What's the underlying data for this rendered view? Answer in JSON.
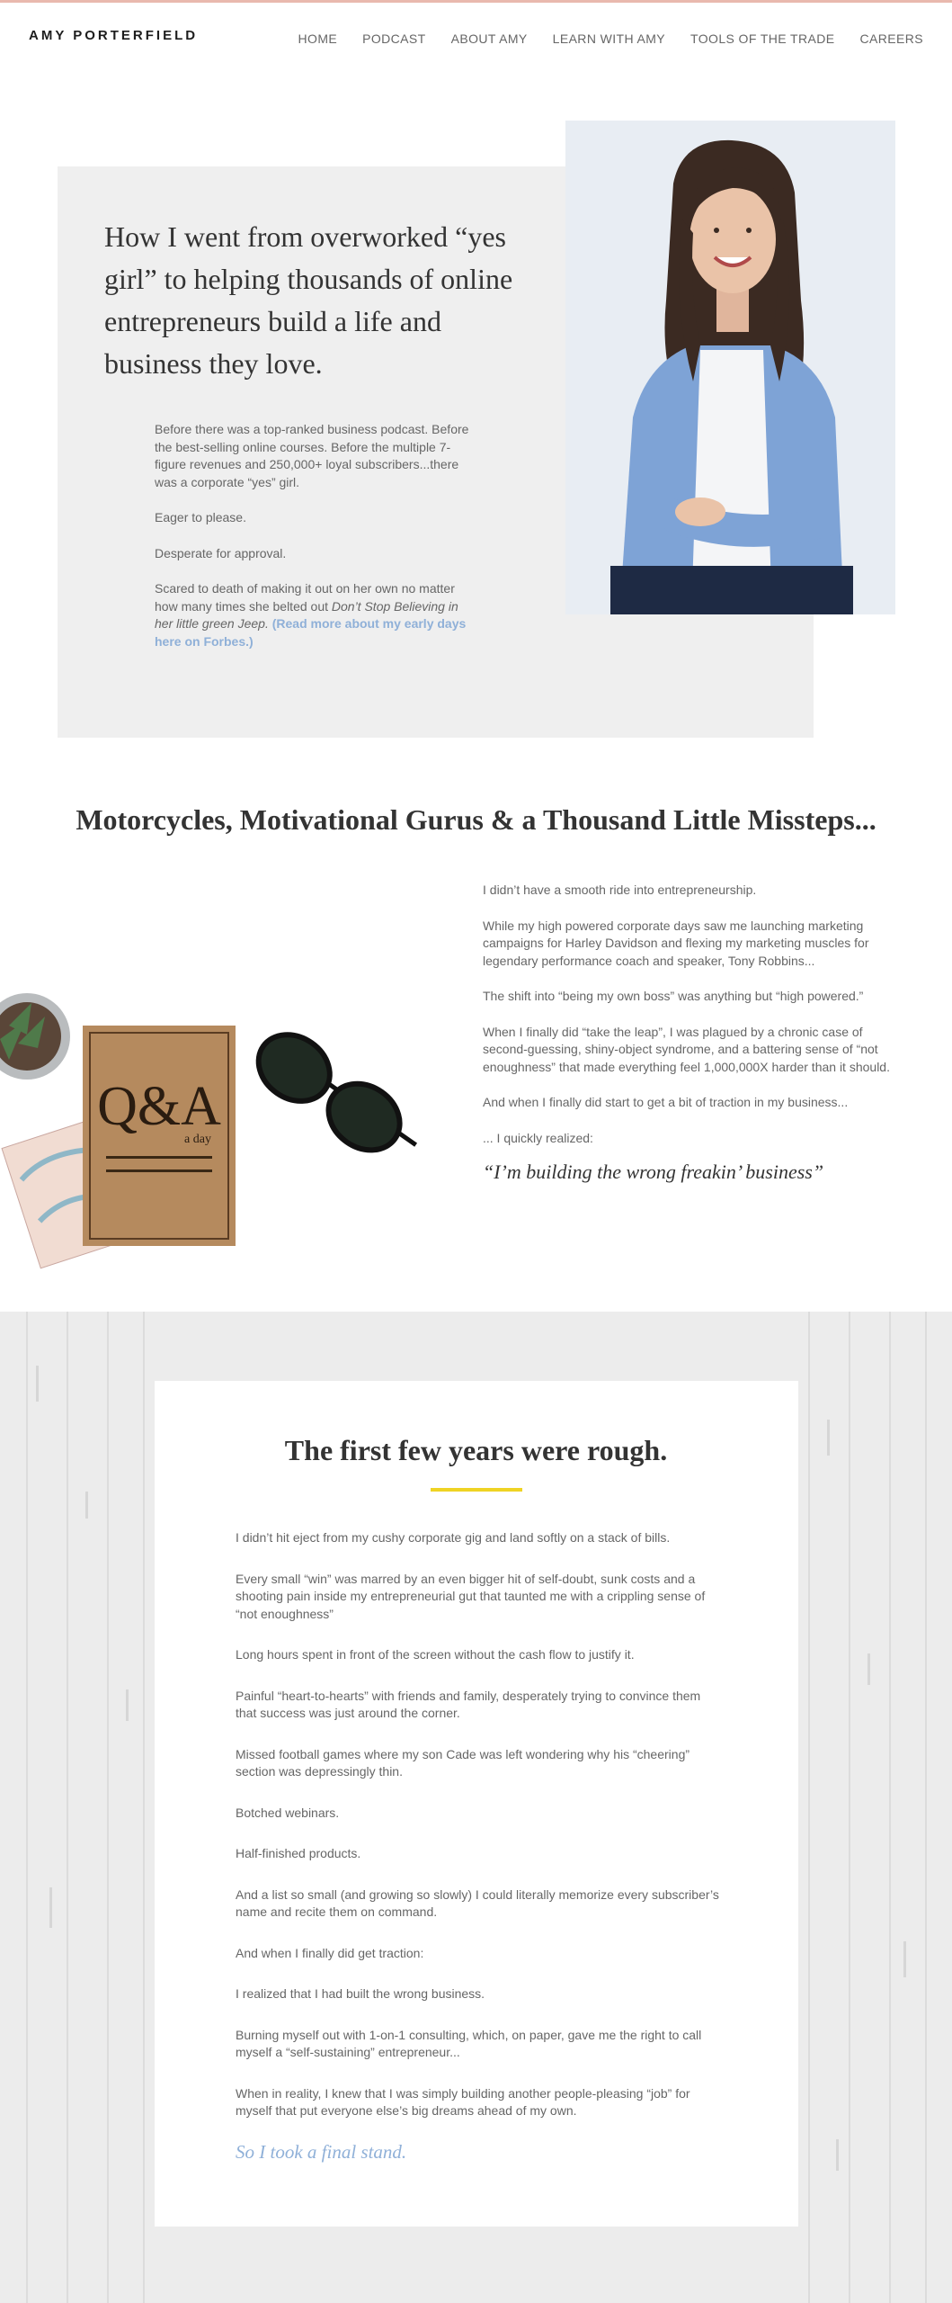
{
  "header": {
    "logo": "AMY PORTERFIELD",
    "nav": [
      "HOME",
      "PODCAST",
      "ABOUT AMY",
      "LEARN WITH AMY",
      "TOOLS OF THE TRADE",
      "CAREERS"
    ]
  },
  "hero": {
    "title": "How I went from overworked “yes girl” to helping thousands of online entrepreneurs build a life and business they love.",
    "p1": "Before there was a top-ranked business podcast. Before the best-selling online courses. Before the multiple 7-figure revenues and 250,000+ loyal subscribers...there was a corporate “yes” girl.",
    "p2": "Eager to please.",
    "p3": "Desperate for approval.",
    "p4_start": "Scared to death of making it out on her own no matter how many times she belted out ",
    "p4_italic": "Don’t Stop Believing in her little green Jeep.",
    "p4_link": "(Read more about my early days here on Forbes.)"
  },
  "section2": {
    "title": "Motorcycles, Motivational Gurus & a Thousand Little Missteps...",
    "paragraphs": [
      "I didn’t have a smooth ride into entrepreneurship.",
      "While my high powered corporate days saw me launching marketing campaigns for Harley Davidson and flexing my marketing muscles for legendary performance coach and speaker, Tony Robbins...",
      "The shift into “being my own boss” was anything but “high powered.”",
      "When I finally did “take the leap”, I was plagued by a chronic case of second-guessing, shiny-object syndrome, and a battering sense of “not enoughness” that made everything feel 1,000,000X harder than it should.",
      "And when I finally did start to get a bit of traction in my business...",
      "... I quickly realized:"
    ],
    "quote": "“I’m building the wrong freakin’ business”",
    "book_title": "Q&A",
    "book_sub": "a day"
  },
  "section3": {
    "title": "The first few years were rough.",
    "paragraphs": [
      "I didn’t hit eject from my cushy corporate gig and land softly on a stack of bills.",
      "Every small “win” was marred by an even bigger hit of self-doubt, sunk costs and a shooting pain inside my entrepreneurial gut that taunted me with a crippling sense of “not enoughness”",
      "Long hours spent in front of the screen without the cash flow to justify it.",
      "Painful “heart-to-hearts” with friends and family, desperately trying to convince them that success was just around the corner.",
      "Missed football games where my son Cade was left wondering why his “cheering” section was depressingly thin.",
      "Botched webinars.",
      "Half-finished products.",
      "And a list so small (and growing so slowly) I could literally memorize every subscriber’s name and recite them on command.",
      "And when I finally did get traction:",
      "I realized that I had built the wrong business.",
      "Burning myself out with 1-on-1 consulting, which, on paper, gave me the right to call myself a “self-sustaining” entrepreneur...",
      "When in reality, I knew that I was simply building another people-pleasing “job” for myself that put everyone else’s big dreams ahead of my own."
    ],
    "quote": "So I took a final stand."
  }
}
